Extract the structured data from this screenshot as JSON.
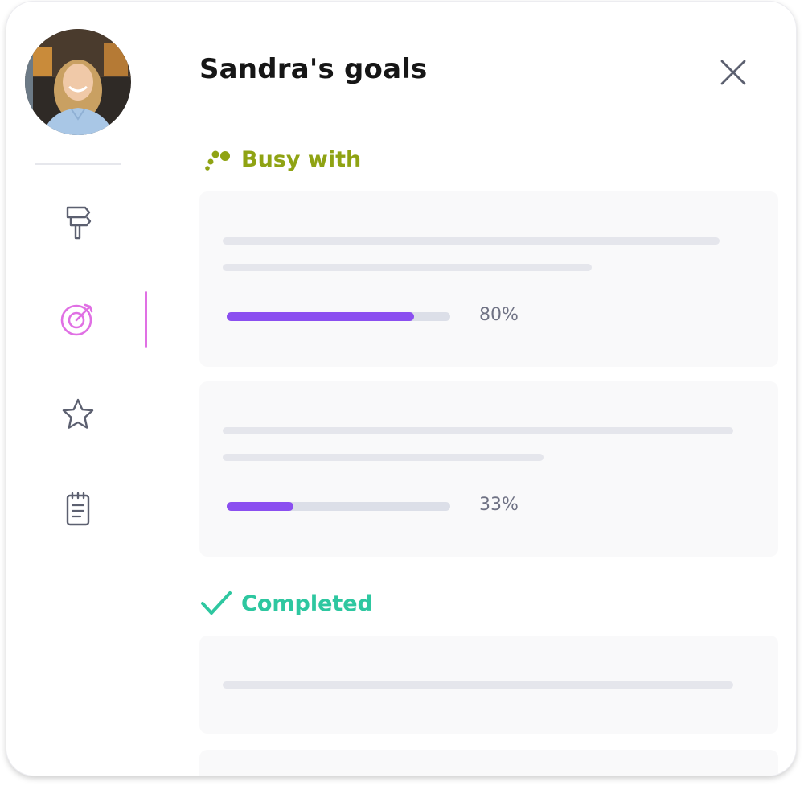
{
  "page": {
    "title": "Sandra's goals"
  },
  "sidebar": {
    "items": [
      {
        "icon": "signpost-icon",
        "active": false
      },
      {
        "icon": "target-icon",
        "active": true
      },
      {
        "icon": "star-icon",
        "active": false
      },
      {
        "icon": "notepad-icon",
        "active": false
      }
    ]
  },
  "sections": {
    "busy": {
      "label": "Busy with",
      "color": "#8fa313",
      "goals": [
        {
          "progress": 0.8,
          "progress_label": "80%"
        },
        {
          "progress": 0.33,
          "progress_label": "33%"
        }
      ]
    },
    "completed": {
      "label": "Completed",
      "color": "#2ec7a0"
    }
  },
  "colors": {
    "accent_purple": "#8b4ff0",
    "active_pink": "#e070e4",
    "icon_gray": "#5c6070"
  }
}
